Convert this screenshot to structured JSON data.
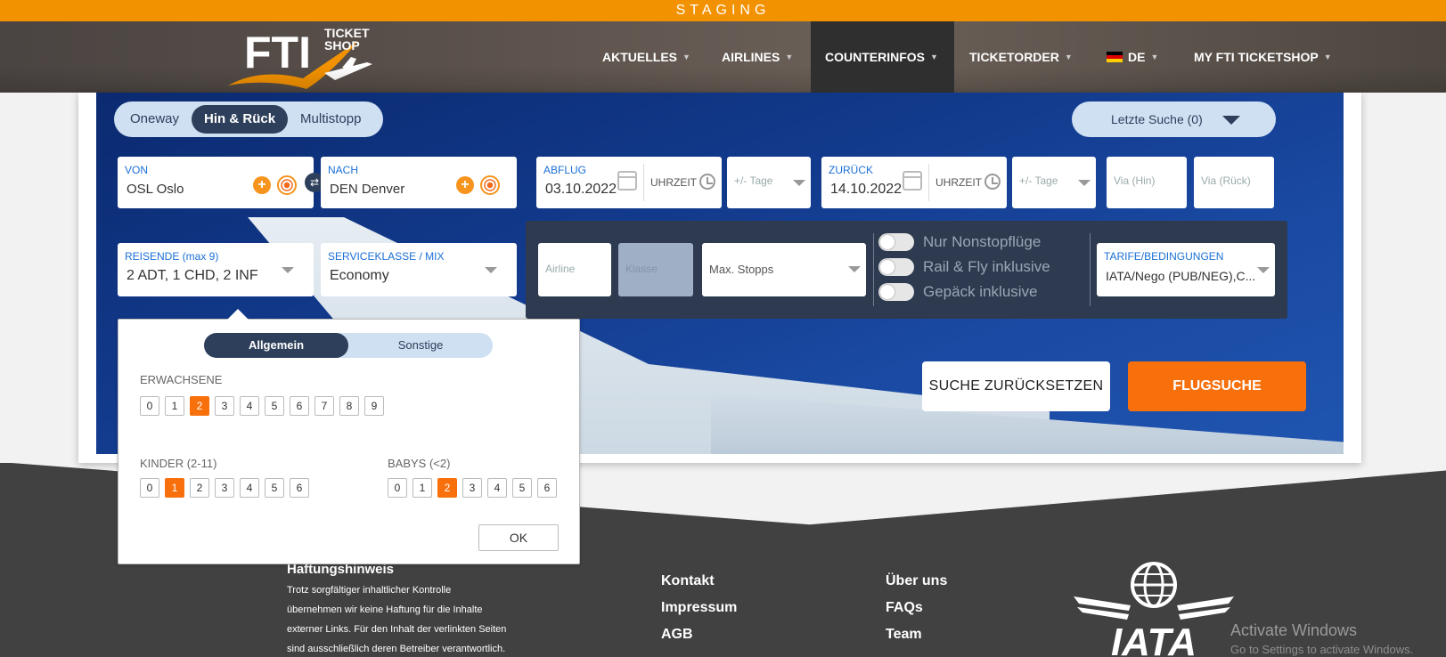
{
  "staging": "STAGING",
  "header": {
    "logo_text_main": "FTI",
    "logo_text_sub1": "TICKET",
    "logo_text_sub2": "SHOP",
    "nav": [
      {
        "label": "AKTUELLES"
      },
      {
        "label": "AIRLINES"
      },
      {
        "label": "COUNTERINFOS"
      },
      {
        "label": "TICKETORDER"
      },
      {
        "label": "DE"
      },
      {
        "label": "MY FTI TICKETSHOP"
      }
    ]
  },
  "trip_type": {
    "options": [
      "Oneway",
      "Hin & Rück",
      "Multistopp"
    ],
    "selected": "Hin & Rück"
  },
  "last_search": {
    "label": "Letzte Suche",
    "count": "(0)"
  },
  "from": {
    "label": "VON",
    "value": "OSL Oslo"
  },
  "to": {
    "label": "NACH",
    "value": "DEN Denver"
  },
  "departure": {
    "label": "ABFLUG",
    "value": "03.10.2022",
    "time_label": "UHRZEIT",
    "flex_placeholder": "+/- Tage"
  },
  "return": {
    "label": "ZURÜCK",
    "value": "14.10.2022",
    "time_label": "UHRZEIT",
    "flex_placeholder": "+/- Tage"
  },
  "via_out": {
    "placeholder": "Via (Hin)"
  },
  "via_back": {
    "placeholder": "Via (Rück)"
  },
  "travellers": {
    "label": "REISENDE (max 9)",
    "value": "2 ADT, 1 CHD, 2 INF"
  },
  "service_class": {
    "label": "SERVICEKLASSE / MIX",
    "value": "Economy"
  },
  "options": {
    "airline_placeholder": "Airline",
    "class_placeholder": "Klasse",
    "max_stops_placeholder": "Max. Stopps",
    "toggles": [
      "Nur Nonstopflüge",
      "Rail & Fly inklusive",
      "Gepäck inklusive"
    ],
    "tariff_label": "TARIFE/BEDINGUNGEN",
    "tariff_value": "IATA/Nego (PUB/NEG),C..."
  },
  "buttons": {
    "reset": "SUCHE ZURÜCKSETZEN",
    "search": "FLUGSUCHE"
  },
  "popup": {
    "tabs": [
      "Allgemein",
      "Sonstige"
    ],
    "adults_label": "ERWACHSENE",
    "adults": [
      "0",
      "1",
      "2",
      "3",
      "4",
      "5",
      "6",
      "7",
      "8",
      "9"
    ],
    "adults_selected": 2,
    "children_label": "KINDER (2-11)",
    "children": [
      "0",
      "1",
      "2",
      "3",
      "4",
      "5",
      "6"
    ],
    "children_selected": 1,
    "babies_label": "BABYS (<2)",
    "babies": [
      "0",
      "1",
      "2",
      "3",
      "4",
      "5",
      "6"
    ],
    "babies_selected": 2,
    "ok": "OK"
  },
  "footer": {
    "disclaimer_title": "Haftungshinweis",
    "disclaimer_lines": [
      "Trotz sorgfältiger inhaltlicher Kontrolle",
      "übernehmen wir keine Haftung für die Inhalte",
      "externer Links. Für den Inhalt der verlinkten Seiten",
      "sind ausschließlich deren Betreiber verantwortlich."
    ],
    "links_col1": [
      "Kontakt",
      "Impressum",
      "AGB"
    ],
    "links_col2": [
      "Über uns",
      "FAQs",
      "Team"
    ],
    "iata": "IATA"
  },
  "windows_watermark": {
    "title": "Activate Windows",
    "sub": "Go to Settings to activate Windows."
  },
  "colors": {
    "accent": "#f7700b",
    "staging": "#f39200",
    "navy": "#2d3f5a"
  }
}
